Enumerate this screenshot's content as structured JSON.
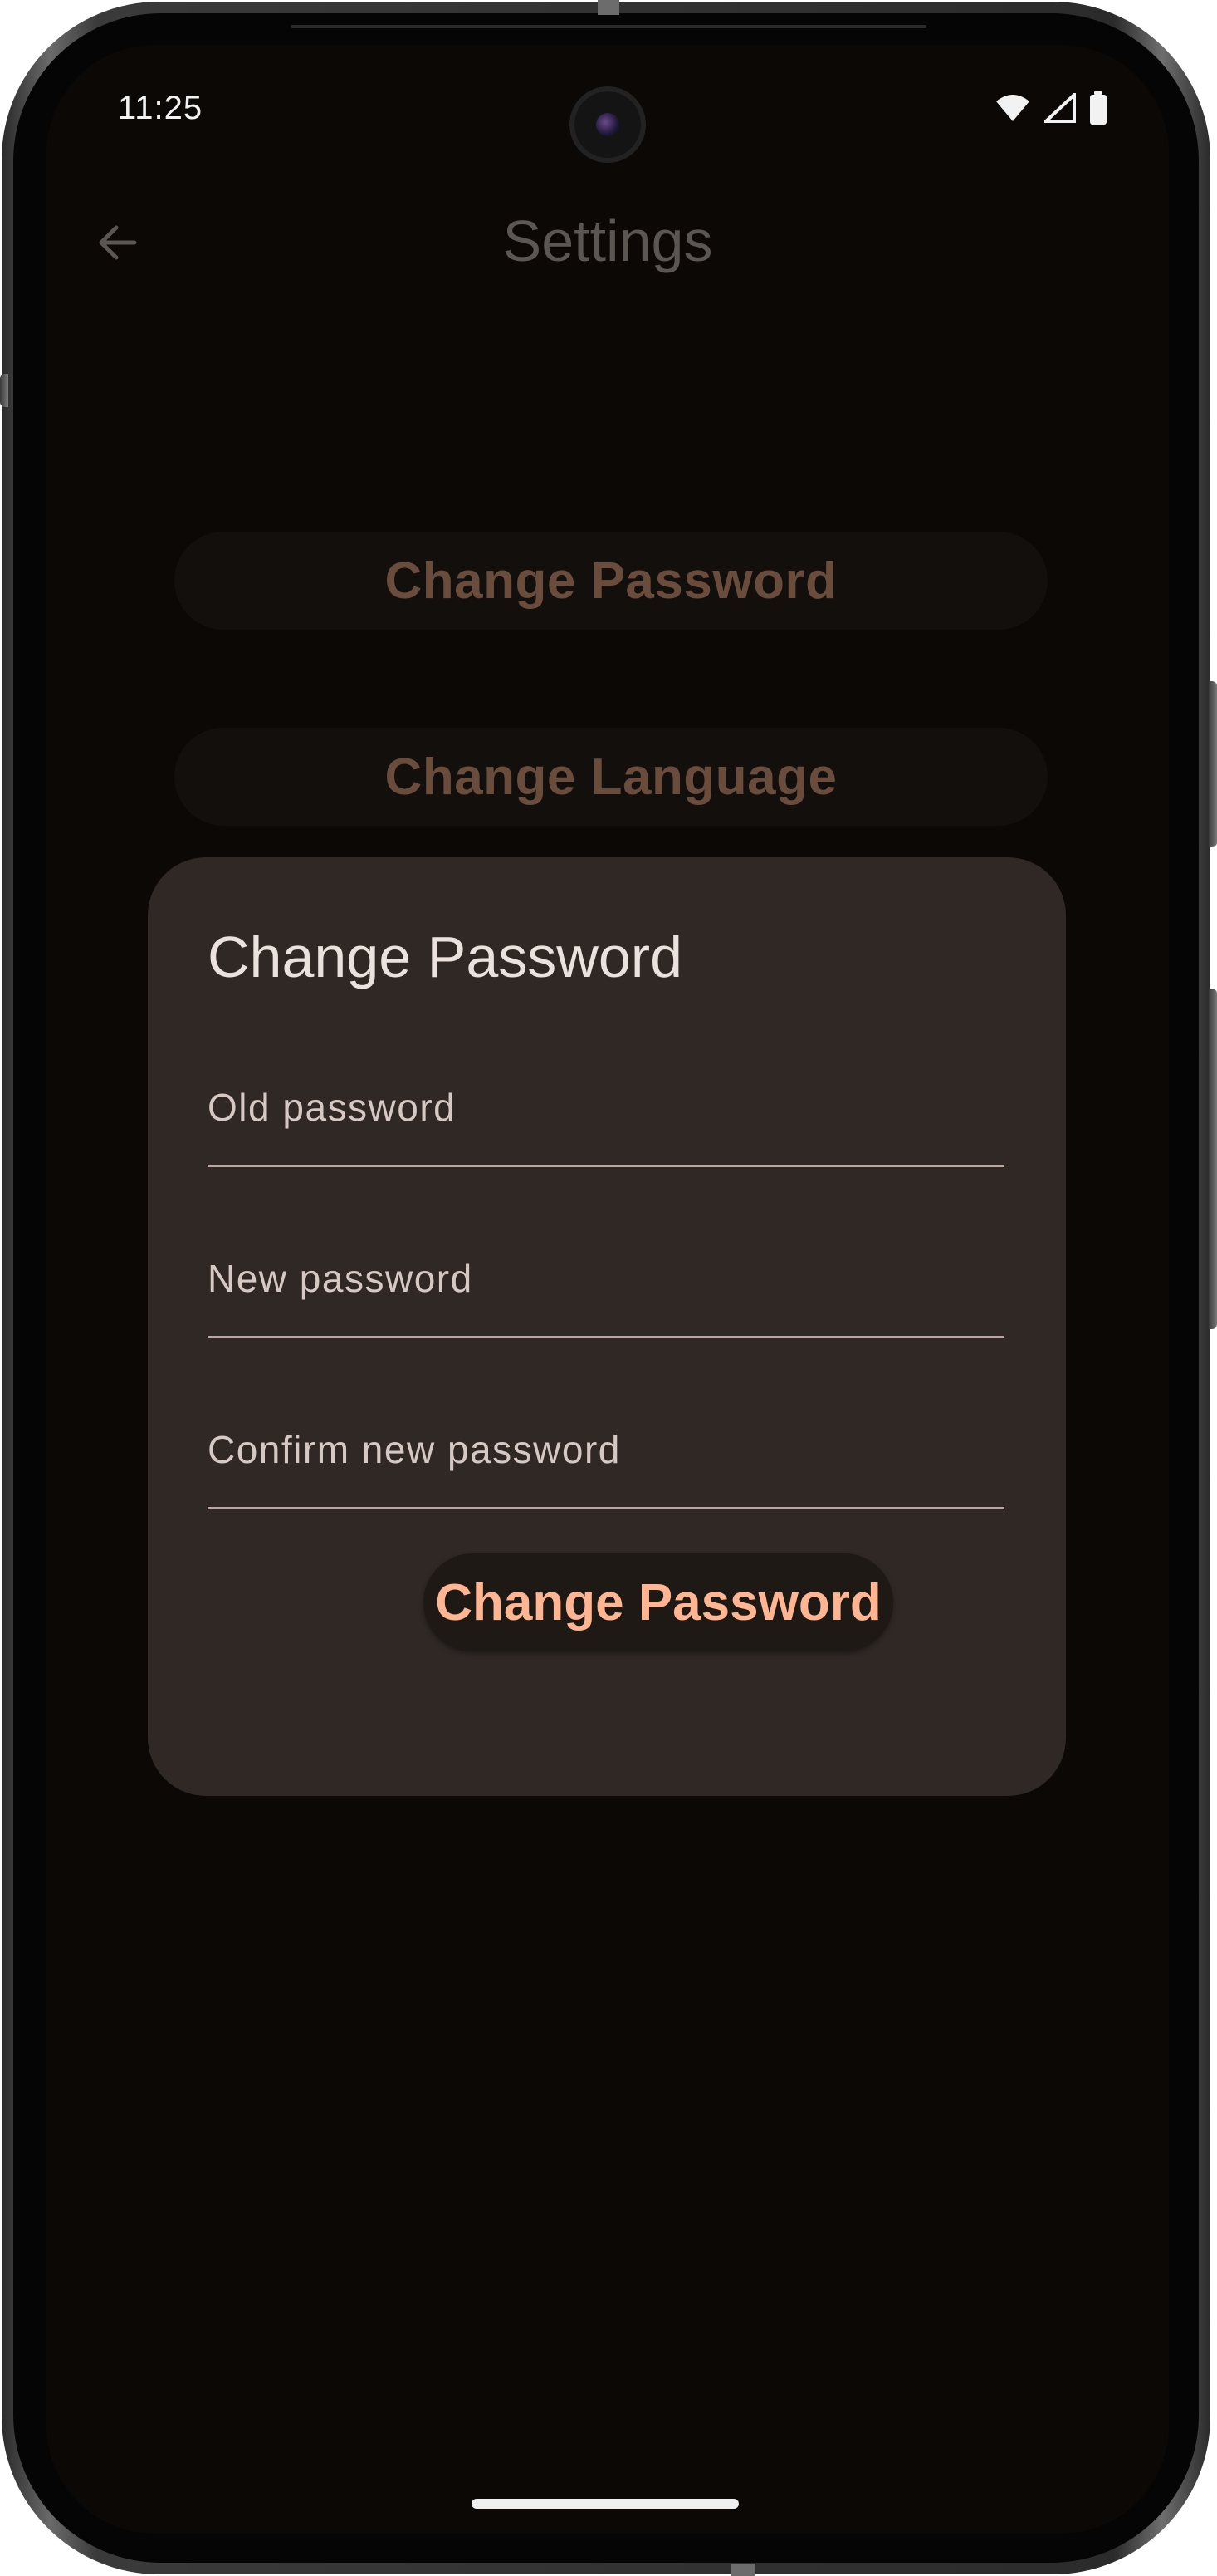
{
  "status_bar": {
    "time": "11:25",
    "icons": [
      "wifi-icon",
      "cell-signal-icon",
      "battery-icon"
    ]
  },
  "app_bar": {
    "back_icon": "arrow-back-icon",
    "title": "Settings"
  },
  "background_buttons": [
    {
      "label": "Change Password"
    },
    {
      "label": "Change Language"
    }
  ],
  "dialog": {
    "title": "Change Password",
    "fields": [
      {
        "label": "Old password",
        "value": ""
      },
      {
        "label": "New password",
        "value": ""
      },
      {
        "label": "Confirm new password",
        "value": ""
      }
    ],
    "submit_label": "Change Password"
  },
  "colors": {
    "screen_background": "#0b0806",
    "dialog_background": "#302825",
    "accent": "#ffb591",
    "dim_accent": "#6a4c3d"
  }
}
